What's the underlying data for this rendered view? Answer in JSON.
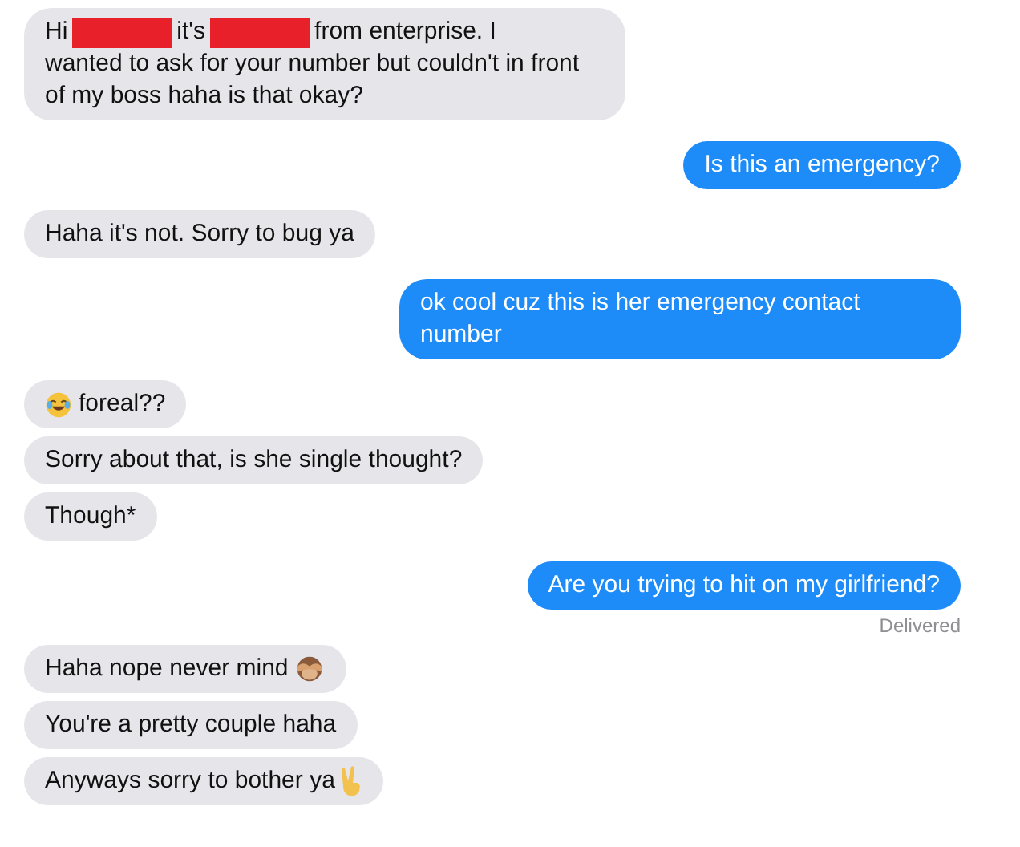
{
  "messages": [
    {
      "outgoing": false,
      "parts": [
        {
          "kind": "text",
          "text": "Hi"
        },
        {
          "kind": "redaction"
        },
        {
          "kind": "text",
          "text": "it's"
        },
        {
          "kind": "redaction"
        },
        {
          "kind": "text",
          "text": "from enterprise. I"
        },
        {
          "kind": "text",
          "text": "wanted to ask for your number but couldn't in front of my boss haha is that okay?"
        }
      ]
    },
    {
      "outgoing": true,
      "parts": [
        {
          "kind": "text",
          "text": "Is this an emergency?"
        }
      ]
    },
    {
      "outgoing": false,
      "parts": [
        {
          "kind": "text",
          "text": "Haha it's not. Sorry to bug ya"
        }
      ]
    },
    {
      "outgoing": true,
      "parts": [
        {
          "kind": "text",
          "text": "ok cool cuz this is her emergency contact number"
        }
      ]
    },
    {
      "outgoing": false,
      "parts": [
        {
          "kind": "laugh_emoji"
        },
        {
          "kind": "text",
          "text": "foreal??"
        }
      ]
    },
    {
      "outgoing": false,
      "parts": [
        {
          "kind": "text",
          "text": "Sorry about that, is she single thought?"
        }
      ]
    },
    {
      "outgoing": false,
      "parts": [
        {
          "kind": "text",
          "text": "Though*"
        }
      ]
    },
    {
      "outgoing": true,
      "parts": [
        {
          "kind": "text",
          "text": "Are you trying to hit on my girlfriend?"
        }
      ],
      "status": "Delivered"
    },
    {
      "outgoing": false,
      "parts": [
        {
          "kind": "text",
          "text": "Haha nope never mind"
        },
        {
          "kind": "monkey_emoji"
        }
      ]
    },
    {
      "outgoing": false,
      "parts": [
        {
          "kind": "text",
          "text": "You're a pretty couple haha"
        }
      ]
    },
    {
      "outgoing": false,
      "parts": [
        {
          "kind": "text",
          "text": "Anyways sorry to bother ya"
        },
        {
          "kind": "peace_emoji"
        }
      ]
    }
  ]
}
